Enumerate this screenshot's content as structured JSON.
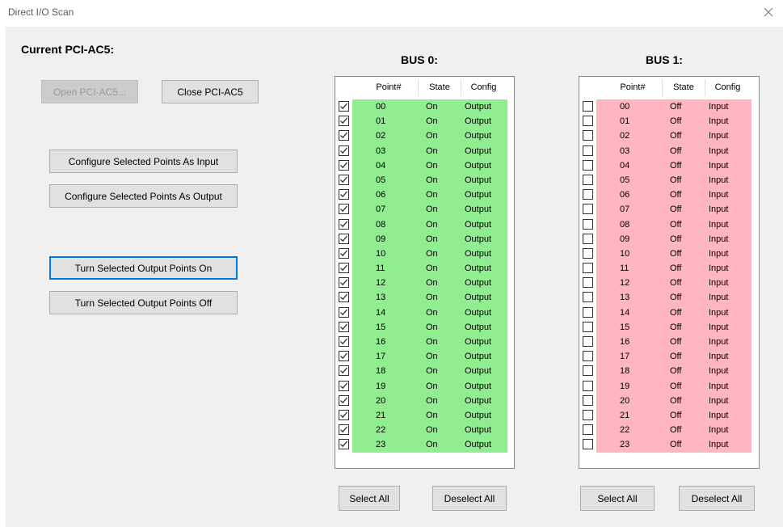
{
  "window": {
    "title": "Direct I/O Scan"
  },
  "left_panel": {
    "header": "Current PCI-AC5:",
    "open_button": "Open PCI-AC5...",
    "close_button": "Close PCI-AC5",
    "config_input_button": "Configure Selected Points As Input",
    "config_output_button": "Configure Selected Points As Output",
    "turn_on_button": "Turn Selected Output Points On",
    "turn_off_button": "Turn Selected Output Points Off"
  },
  "columns": {
    "point": "Point#",
    "state": "State",
    "config": "Config"
  },
  "colors": {
    "on_row": "#90ee90",
    "off_row": "#ffb6c1"
  },
  "bus0": {
    "title": "BUS 0:",
    "select_all": "Select All",
    "deselect_all": "Deselect All",
    "rows": [
      {
        "checked": true,
        "point": "00",
        "state": "On",
        "config": "Output"
      },
      {
        "checked": true,
        "point": "01",
        "state": "On",
        "config": "Output"
      },
      {
        "checked": true,
        "point": "02",
        "state": "On",
        "config": "Output"
      },
      {
        "checked": true,
        "point": "03",
        "state": "On",
        "config": "Output"
      },
      {
        "checked": true,
        "point": "04",
        "state": "On",
        "config": "Output"
      },
      {
        "checked": true,
        "point": "05",
        "state": "On",
        "config": "Output"
      },
      {
        "checked": true,
        "point": "06",
        "state": "On",
        "config": "Output"
      },
      {
        "checked": true,
        "point": "07",
        "state": "On",
        "config": "Output"
      },
      {
        "checked": true,
        "point": "08",
        "state": "On",
        "config": "Output"
      },
      {
        "checked": true,
        "point": "09",
        "state": "On",
        "config": "Output"
      },
      {
        "checked": true,
        "point": "10",
        "state": "On",
        "config": "Output"
      },
      {
        "checked": true,
        "point": "11",
        "state": "On",
        "config": "Output"
      },
      {
        "checked": true,
        "point": "12",
        "state": "On",
        "config": "Output"
      },
      {
        "checked": true,
        "point": "13",
        "state": "On",
        "config": "Output"
      },
      {
        "checked": true,
        "point": "14",
        "state": "On",
        "config": "Output"
      },
      {
        "checked": true,
        "point": "15",
        "state": "On",
        "config": "Output"
      },
      {
        "checked": true,
        "point": "16",
        "state": "On",
        "config": "Output"
      },
      {
        "checked": true,
        "point": "17",
        "state": "On",
        "config": "Output"
      },
      {
        "checked": true,
        "point": "18",
        "state": "On",
        "config": "Output"
      },
      {
        "checked": true,
        "point": "19",
        "state": "On",
        "config": "Output"
      },
      {
        "checked": true,
        "point": "20",
        "state": "On",
        "config": "Output"
      },
      {
        "checked": true,
        "point": "21",
        "state": "On",
        "config": "Output"
      },
      {
        "checked": true,
        "point": "22",
        "state": "On",
        "config": "Output"
      },
      {
        "checked": true,
        "point": "23",
        "state": "On",
        "config": "Output"
      }
    ]
  },
  "bus1": {
    "title": "BUS 1:",
    "select_all": "Select All",
    "deselect_all": "Deselect All",
    "rows": [
      {
        "checked": false,
        "point": "00",
        "state": "Off",
        "config": "Input"
      },
      {
        "checked": false,
        "point": "01",
        "state": "Off",
        "config": "Input"
      },
      {
        "checked": false,
        "point": "02",
        "state": "Off",
        "config": "Input"
      },
      {
        "checked": false,
        "point": "03",
        "state": "Off",
        "config": "Input"
      },
      {
        "checked": false,
        "point": "04",
        "state": "Off",
        "config": "Input"
      },
      {
        "checked": false,
        "point": "05",
        "state": "Off",
        "config": "Input"
      },
      {
        "checked": false,
        "point": "06",
        "state": "Off",
        "config": "Input"
      },
      {
        "checked": false,
        "point": "07",
        "state": "Off",
        "config": "Input"
      },
      {
        "checked": false,
        "point": "08",
        "state": "Off",
        "config": "Input"
      },
      {
        "checked": false,
        "point": "09",
        "state": "Off",
        "config": "Input"
      },
      {
        "checked": false,
        "point": "10",
        "state": "Off",
        "config": "Input"
      },
      {
        "checked": false,
        "point": "11",
        "state": "Off",
        "config": "Input"
      },
      {
        "checked": false,
        "point": "12",
        "state": "Off",
        "config": "Input"
      },
      {
        "checked": false,
        "point": "13",
        "state": "Off",
        "config": "Input"
      },
      {
        "checked": false,
        "point": "14",
        "state": "Off",
        "config": "Input"
      },
      {
        "checked": false,
        "point": "15",
        "state": "Off",
        "config": "Input"
      },
      {
        "checked": false,
        "point": "16",
        "state": "Off",
        "config": "Input"
      },
      {
        "checked": false,
        "point": "17",
        "state": "Off",
        "config": "Input"
      },
      {
        "checked": false,
        "point": "18",
        "state": "Off",
        "config": "Input"
      },
      {
        "checked": false,
        "point": "19",
        "state": "Off",
        "config": "Input"
      },
      {
        "checked": false,
        "point": "20",
        "state": "Off",
        "config": "Input"
      },
      {
        "checked": false,
        "point": "21",
        "state": "Off",
        "config": "Input"
      },
      {
        "checked": false,
        "point": "22",
        "state": "Off",
        "config": "Input"
      },
      {
        "checked": false,
        "point": "23",
        "state": "Off",
        "config": "Input"
      }
    ]
  }
}
